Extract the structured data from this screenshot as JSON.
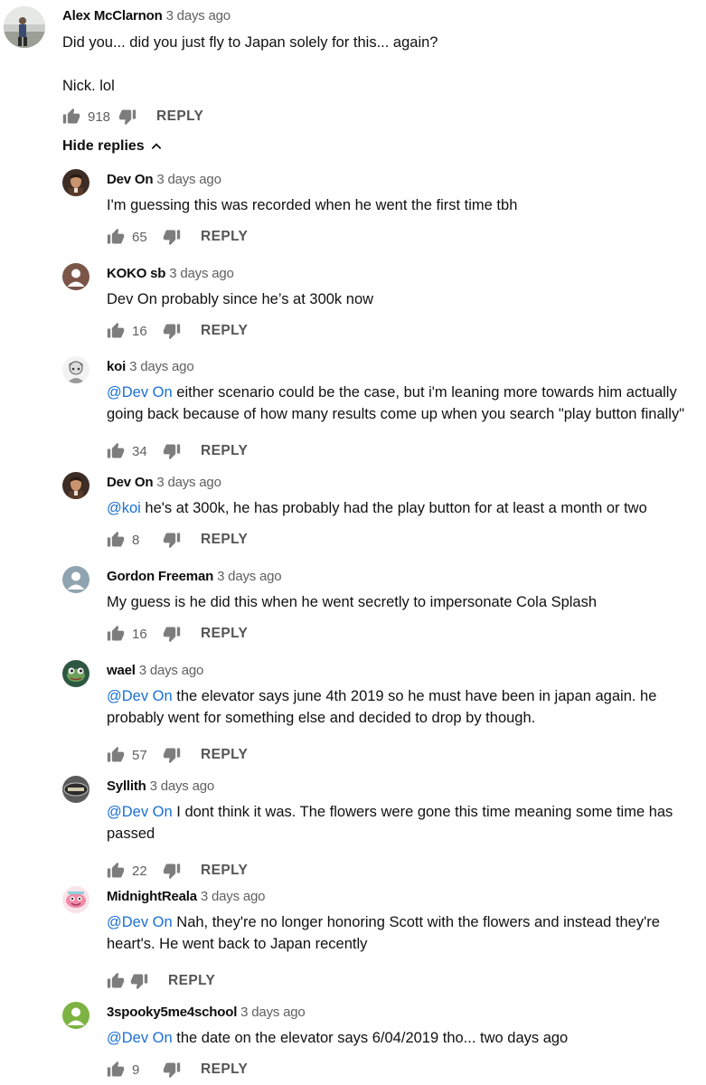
{
  "main_comment": {
    "author": "Alex McClarnon",
    "time": "3 days ago",
    "line1": "Did you... did you just fly to Japan solely for this... again?",
    "line2": "Nick. lol",
    "likes": "918",
    "reply_label": "REPLY"
  },
  "hide_replies_label": "Hide replies",
  "replies": [
    {
      "author": "Dev On",
      "time": "3 days ago",
      "mention": "",
      "text1": "I'm guessing this was recorded when he went the first time tbh",
      "text2": "",
      "likes": "65",
      "reply_label": "REPLY",
      "avatar_icon": "portrait-avatar-icon"
    },
    {
      "author": "KOKO sb",
      "time": "3 days ago",
      "mention": "",
      "text1": "Dev On probably since he’s at 300k now",
      "text2": "",
      "likes": "16",
      "reply_label": "REPLY",
      "avatar_icon": "default-user-avatar-icon"
    },
    {
      "author": "koi",
      "time": "3 days ago",
      "mention": "@Dev On",
      "text1": " either scenario could be the case, but i'm leaning more towards him actually",
      "text2": "going back because of how many results come up when you search \"play button finally\"",
      "likes": "34",
      "reply_label": "REPLY",
      "avatar_icon": "anime-avatar-icon"
    },
    {
      "author": "Dev On",
      "time": "3 days ago",
      "mention": "@koi",
      "text1": " he's at 300k, he has probably had the play button for at least a month or two",
      "text2": "",
      "likes": "8",
      "reply_label": "REPLY",
      "avatar_icon": "portrait-avatar-icon"
    },
    {
      "author": "Gordon Freeman",
      "time": "3 days ago",
      "mention": "",
      "text1": "My guess is he did this when he went secretly to impersonate Cola Splash",
      "text2": "",
      "likes": "16",
      "reply_label": "REPLY",
      "avatar_icon": "default-user-avatar-icon"
    },
    {
      "author": "wael",
      "time": "3 days ago",
      "mention": "@Dev On",
      "text1": " the elevator says june 4th 2019 so he must have been in japan again. he",
      "text2": "probably went for something else and decided to drop by though.",
      "likes": "57",
      "reply_label": "REPLY",
      "avatar_icon": "frog-avatar-icon"
    },
    {
      "author": "Syllith",
      "time": "3 days ago",
      "mention": "@Dev On",
      "text1": " I dont think it was. The flowers were gone this time meaning some time has",
      "text2": "passed",
      "likes": "22",
      "reply_label": "REPLY",
      "avatar_icon": "logo-avatar-icon"
    },
    {
      "author": "MidnightReala",
      "time": "3 days ago",
      "mention": "@Dev On",
      "text1": " Nah, they're no longer honoring Scott with the flowers and instead they're",
      "text2": "heart's. He went back to Japan recently",
      "likes": "",
      "reply_label": "REPLY",
      "avatar_icon": "pink-avatar-icon"
    },
    {
      "author": "3spooky5me4school",
      "time": "3 days ago",
      "mention": "@Dev On",
      "text1": " the date on the elevator says 6/04/2019 tho... two days ago",
      "text2": "",
      "likes": "9",
      "reply_label": "REPLY",
      "avatar_icon": "default-user-avatar-icon"
    }
  ],
  "colors": {
    "mention": "#1a6fd6",
    "secondary_text": "#606060",
    "avatar_koko": "#7a5548",
    "avatar_gordon": "#8fa3b0",
    "avatar_spooky": "#7cb342"
  }
}
